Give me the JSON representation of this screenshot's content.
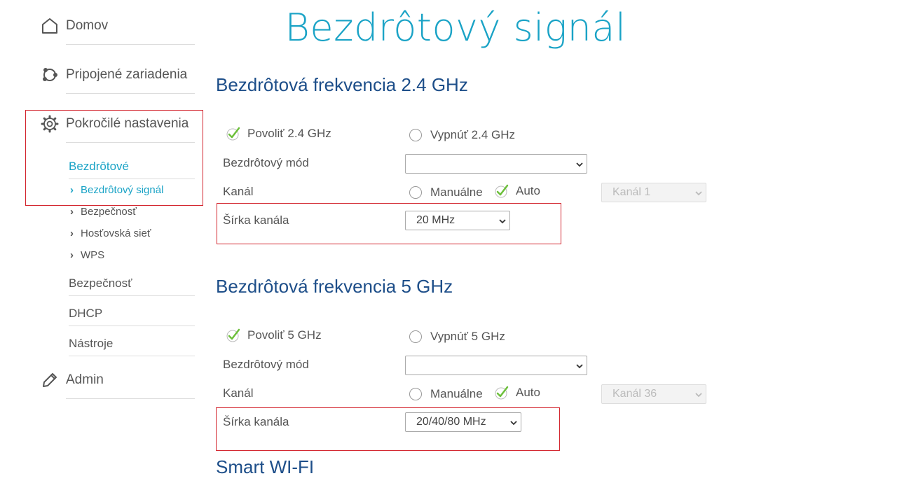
{
  "title": "Bezdrôtový signál",
  "sidebar": {
    "home": "Domov",
    "devices": "Pripojené zariadenia",
    "advanced": "Pokročilé nastavenia",
    "wireless": "Bezdrôtové",
    "wireless_items": [
      "Bezdrôtový signál",
      "Bezpečnosť",
      "Hosťovská sieť",
      "WPS"
    ],
    "security": "Bezpečnosť",
    "dhcp": "DHCP",
    "tools": "Nástroje",
    "admin": "Admin"
  },
  "band24": {
    "heading": "Bezdrôtová frekvencia 2.4 GHz",
    "enable": "Povoliť 2.4 GHz",
    "disable": "Vypnúť 2.4 GHz",
    "mode_label": "Bezdrôtový mód",
    "mode_value": "",
    "channel_label": "Kanál",
    "manual": "Manuálne",
    "auto": "Auto",
    "channel_value": "Kanál 1",
    "width_label": "Šírka kanála",
    "width_value": "20 MHz"
  },
  "band5": {
    "heading": "Bezdrôtová frekvencia 5 GHz",
    "enable": "Povoliť 5 GHz",
    "disable": "Vypnúť 5 GHz",
    "mode_label": "Bezdrôtový mód",
    "mode_value": "",
    "channel_label": "Kanál",
    "manual": "Manuálne",
    "auto": "Auto",
    "channel_value": "Kanál 36",
    "width_label": "Šírka kanála",
    "width_value": "20/40/80 MHz"
  },
  "smart_wifi": "Smart WI-FI",
  "colors": {
    "accent": "#1aa3c6",
    "heading": "#1d4e89",
    "highlight": "#d3262f",
    "check": "#6cbf3a"
  }
}
